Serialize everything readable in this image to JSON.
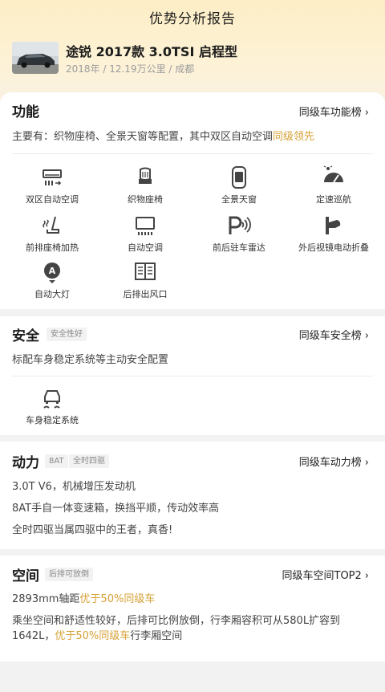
{
  "header": {
    "title": "优势分析报告",
    "car_name": "途锐 2017款 3.0TSI 启程型",
    "car_meta": "2018年 / 12.19万公里 / 成都"
  },
  "function_section": {
    "title": "功能",
    "rank_link": "同级车功能榜",
    "desc_prefix": "主要有：织物座椅、全景天窗等配置，其中双区自动空调",
    "desc_highlight": "同级领先",
    "features": [
      {
        "label": "双区自动空调",
        "icon": "dual-zone-ac-icon"
      },
      {
        "label": "织物座椅",
        "icon": "fabric-seat-icon"
      },
      {
        "label": "全景天窗",
        "icon": "panoramic-sunroof-icon"
      },
      {
        "label": "定速巡航",
        "icon": "cruise-control-icon"
      },
      {
        "label": "前排座椅加热",
        "icon": "seat-heating-icon"
      },
      {
        "label": "自动空调",
        "icon": "auto-ac-icon"
      },
      {
        "label": "前后驻车雷达",
        "icon": "parking-radar-icon"
      },
      {
        "label": "外后视镜电动折叠",
        "icon": "mirror-fold-icon"
      },
      {
        "label": "自动大灯",
        "icon": "auto-headlight-icon"
      },
      {
        "label": "后排出风口",
        "icon": "rear-vent-icon"
      }
    ]
  },
  "safety_section": {
    "title": "安全",
    "tag": "安全性好",
    "rank_link": "同级车安全榜",
    "desc": "标配车身稳定系统等主动安全配置",
    "features": [
      {
        "label": "车身稳定系统",
        "icon": "stability-control-icon"
      }
    ]
  },
  "power_section": {
    "title": "动力",
    "tags": [
      "8AT",
      "全时四驱"
    ],
    "rank_link": "同级车动力榜",
    "lines": [
      "3.0T V6，机械增压发动机",
      "8AT手自一体变速箱，换挡平顺，传动效率高",
      "全时四驱当属四驱中的王者，真香!"
    ]
  },
  "space_section": {
    "title": "空间",
    "tag": "后排可放倒",
    "rank_link": "同级车空间TOP2",
    "line1_prefix": "2893mm轴距",
    "line1_highlight": "优于50%同级车",
    "line2": "乘坐空间和舒适性较好，后排可比例放倒，行李厢容积可从580L扩容到",
    "line3_prefix": "1642L，",
    "line3_highlight": "优于50%同级车",
    "line3_suffix": "行李厢空间"
  },
  "colors": {
    "accent": "#d6a136",
    "hero_bg": "#fdeec6"
  }
}
